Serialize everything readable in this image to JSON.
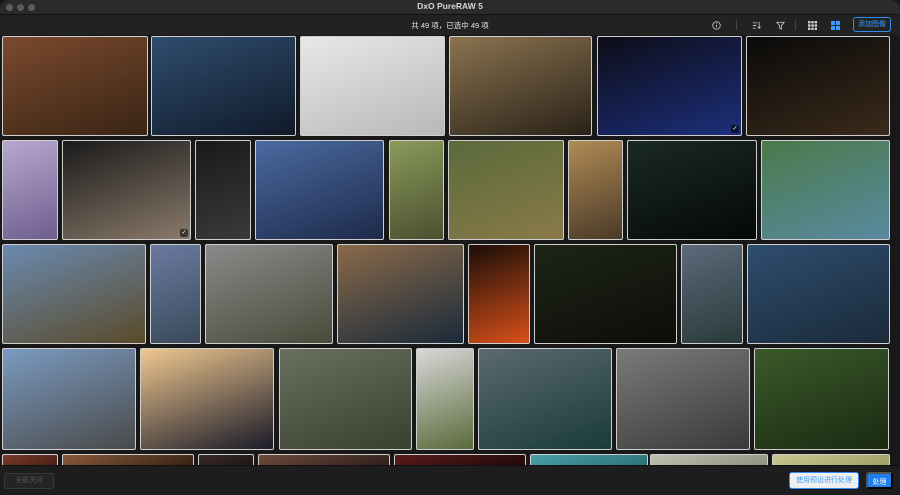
{
  "window": {
    "title": "DxO PureRAW 5"
  },
  "toolbar": {
    "selection_text": "共 49 项，已选中 49 项",
    "add_images_label": "添加图像",
    "icons": [
      "info-icon",
      "sort-icon",
      "filter-icon",
      "grid-view-icon",
      "mosaic-view-icon"
    ]
  },
  "photos": [
    {
      "desc": "leopard",
      "c1": "#7a4a2e",
      "c2": "#3a2414",
      "selected": false
    },
    {
      "desc": "woman-portrait",
      "c1": "#2f4d6e",
      "c2": "#101a2a",
      "selected": false
    },
    {
      "desc": "library-atrium",
      "c1": "#e8e8e8",
      "c2": "#b8b8b8",
      "selected": false
    },
    {
      "desc": "opera-hall",
      "c1": "#8a7350",
      "c2": "#2a2218",
      "selected": false
    },
    {
      "desc": "dancers-blue",
      "c1": "#0d0d18",
      "c2": "#1c2f7a",
      "selected": true
    },
    {
      "desc": "dance-troupe",
      "c1": "#0a0a0a",
      "c2": "#3a2a1a",
      "selected": false
    },
    {
      "desc": "dancers-purple",
      "c1": "#b8a8cf",
      "c2": "#6d5e8e",
      "selected": false
    },
    {
      "desc": "dance-group-bw",
      "c1": "#1a1a1a",
      "c2": "#8a7a6a",
      "selected": true
    },
    {
      "desc": "dancer-dark",
      "c1": "#1a1a1a",
      "c2": "#3a3a3a",
      "selected": false
    },
    {
      "desc": "tower-blue",
      "c1": "#4a6aa0",
      "c2": "#1d2a4a",
      "selected": false
    },
    {
      "desc": "monkey",
      "c1": "#8a9a5a",
      "c2": "#4a5030",
      "selected": false
    },
    {
      "desc": "leopards-grass",
      "c1": "#5a6a3a",
      "c2": "#8a7a4a",
      "selected": false
    },
    {
      "desc": "cathedral-nave",
      "c1": "#b08a55",
      "c2": "#4a3a28",
      "selected": false
    },
    {
      "desc": "aurora-night",
      "c1": "#1a2a22",
      "c2": "#050808",
      "selected": false
    },
    {
      "desc": "lake-aerial",
      "c1": "#4a7a4a",
      "c2": "#5a8aa0",
      "selected": false
    },
    {
      "desc": "mountain-peak",
      "c1": "#6a8ab0",
      "c2": "#5a4a2a",
      "selected": false
    },
    {
      "desc": "lighthouse",
      "c1": "#6a7aa0",
      "c2": "#3a4a5a",
      "selected": false
    },
    {
      "desc": "valley-aerial",
      "c1": "#8a8a8a",
      "c2": "#4a4a3a",
      "selected": false
    },
    {
      "desc": "iceberg-dusk",
      "c1": "#8a6a4a",
      "c2": "#1a2a3a",
      "selected": false
    },
    {
      "desc": "volcano",
      "c1": "#1a0e08",
      "c2": "#d8501a",
      "selected": false
    },
    {
      "desc": "dark-forest",
      "c1": "#1e2418",
      "c2": "#0c0e08",
      "selected": false
    },
    {
      "desc": "waterfall-mountains",
      "c1": "#5a6a7a",
      "c2": "#2a3a3a",
      "selected": false
    },
    {
      "desc": "woman-portrait-2",
      "c1": "#2f4d6e",
      "c2": "#1a2a3a",
      "selected": false
    },
    {
      "desc": "courtyard-sky",
      "c1": "#7a9ac0",
      "c2": "#4a4a4a",
      "selected": false
    },
    {
      "desc": "eiffel-sunset",
      "c1": "#f0c890",
      "c2": "#1a1a28",
      "selected": false
    },
    {
      "desc": "toucan-branch",
      "c1": "#6a7060",
      "c2": "#3a4030",
      "selected": false
    },
    {
      "desc": "girl-umbrella",
      "c1": "#d8d8d8",
      "c2": "#5a6a3a",
      "selected": false
    },
    {
      "desc": "ocean-wave",
      "c1": "#5a6a70",
      "c2": "#1a3a3a",
      "selected": false
    },
    {
      "desc": "cathedral-interior",
      "c1": "#7a7a78",
      "c2": "#3a3a38",
      "selected": false
    },
    {
      "desc": "tamarin-monkey",
      "c1": "#3a5a2a",
      "c2": "#1a2a12",
      "selected": false
    },
    {
      "desc": "partial-1",
      "c1": "#7a3a2a",
      "c2": "#3a1a10",
      "selected": false
    },
    {
      "desc": "partial-2",
      "c1": "#8a5a3a",
      "c2": "#2a1a10",
      "selected": false
    },
    {
      "desc": "partial-3",
      "c1": "#3a2a2a",
      "c2": "#1a1010",
      "selected": false
    },
    {
      "desc": "partial-4",
      "c1": "#6a4a3a",
      "c2": "#2a1a1a",
      "selected": false
    },
    {
      "desc": "partial-5",
      "c1": "#5a1a1a",
      "c2": "#1a0808",
      "selected": false
    },
    {
      "desc": "partial-6",
      "c1": "#4aa0a8",
      "c2": "#2a6a70",
      "selected": false
    },
    {
      "desc": "partial-7",
      "c1": "#c0c0b0",
      "c2": "#8a8a78",
      "selected": false
    },
    {
      "desc": "partial-8",
      "c1": "#c8c890",
      "c2": "#9a9a60",
      "selected": false
    }
  ],
  "footer": {
    "close_label": "全部关闭",
    "use_preset_label": "使用预设进行处理",
    "process_label": "处理"
  }
}
